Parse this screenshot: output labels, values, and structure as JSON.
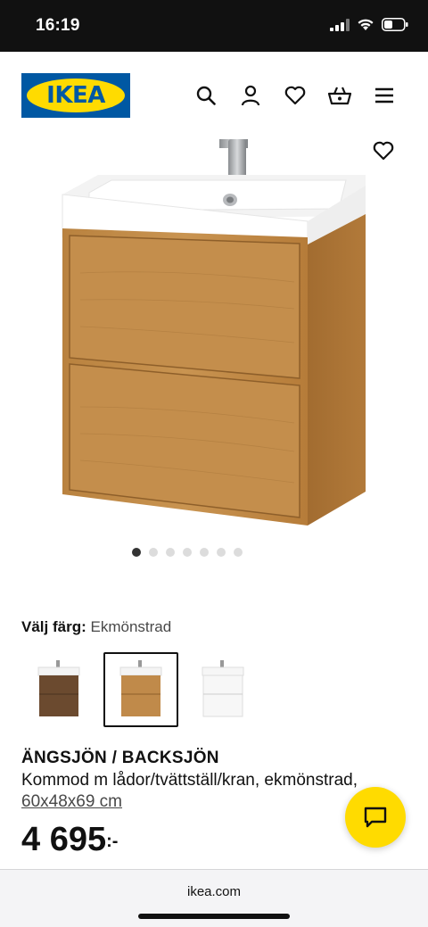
{
  "status_bar": {
    "time": "16:19"
  },
  "header": {
    "logo_text": "IKEA",
    "icons": [
      "search-icon",
      "account-icon",
      "heart-icon",
      "basket-icon",
      "menu-icon"
    ]
  },
  "gallery": {
    "total_images": 7,
    "active_index": 0
  },
  "color_selector": {
    "label": "Välj färg:",
    "value": "Ekmönstrad",
    "options": [
      {
        "name": "brown-oak",
        "color": "#6b4a2f"
      },
      {
        "name": "oak-effect",
        "color": "#c08a4a",
        "selected": true
      },
      {
        "name": "white",
        "color": "#f4f4f4"
      }
    ]
  },
  "product": {
    "title": "ÄNGSJÖN / BACKSJÖN",
    "description": "Kommod m lådor/tvättställ/kran, ekmönstrad,",
    "dimensions": "60x48x69 cm",
    "price": "4 695",
    "price_suffix": ":-"
  },
  "browser": {
    "url": "ikea.com"
  },
  "colors": {
    "ikea_blue": "#0058a3",
    "ikea_yellow": "#ffdb00"
  }
}
